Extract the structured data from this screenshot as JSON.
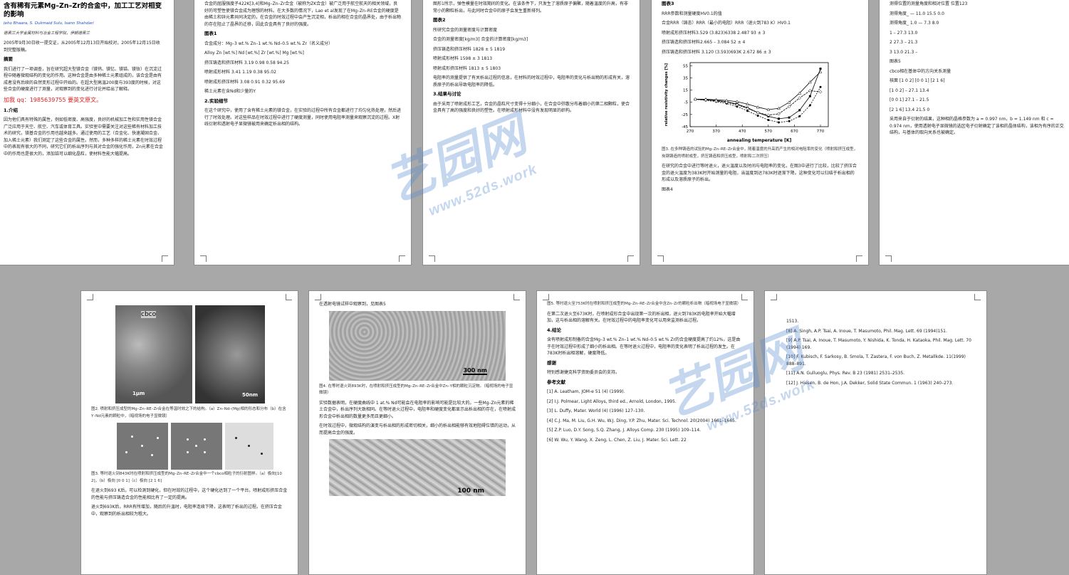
{
  "watermark": {
    "text_cn": "艺园网",
    "url": "www.52ds.work"
  },
  "page1": {
    "title": "含有稀有元素Mg–Zn–Zr的合金中，加工工艺对相变的影响",
    "authors": "Jeho Bhaara, S. Dukmaid Sulu, Isann Shahdari",
    "affil": "德黑兰大学金属材料与冶金工程学院，伊朗德黑兰",
    "dates": "2005年9月30日收一提交证，从2005年12月13日开始校对，2005年12月15日收到完整版稿。",
    "abs_h": "摘要",
    "abs": "我们进行了一项调查，旨在研究超大型镁合金（镁钨、镁钇、镁锆、镁钕）在沉淀过程中随着微观结构的变化的作用。这种合金是由多种稀土元素组成的，该合金是由有成者没有后续的自然变形过程中开始的。在超大型高温200度与393度的时候，对这些合金的硬度进行了测量，对观察到的变化进行讨论并给出了解释。",
    "contact": "加我 qq：1985639755    要英文原文。",
    "intro_h": "1.介绍",
    "intro": "因为他们具有特殊的属性，例如低密度、高强度，良好的机械加工性和实用性镁合金广泛应用于天空、航空、汽车或体育工具。实验室中需要关注对这些稀有材料加工技术的研究，镁基合金的引用也越来越多。通过使用的工艺（合金化、快速凝固合金、加入稀土元素）我们测定了这些合金的属性。然而，多种多样的稀土元素在时效过程中的表现有很大的不同，研究它们的析出序列与其对合金的强化作用，Zn元素在合金中的作用也是很大的，添加锆可以细化晶粒，使材料性能大幅提高。"
  },
  "page2": {
    "p1": "合金的屈服强度子422K[3,4]和Mg–Zn–Zr合金（被称为ZK合金）被广泛用于航空航天的相关领域，良好的可塑性使镁合金成为理想的材料。在大多数的情况下，Lao et al发现了在Mg–Zn–RE合金的硬度是由稀土和锌元素共同决定的，在合金的时效过程中会产生沉淀相，析出的相在合金的晶界处，由于析出物的存在阻止了晶界的迁移，因此合金具有了良好的强度。",
    "list_h": "图表1",
    "list": [
      "合金成分：Mg–3 wt.% Zn–1 wt.% Nd–0.5 wt.% Zr（名义成分）",
      "Alloy Zn [wt.%] Nd [wt.%] Zr [wt.%] Mg [wt.%]",
      "挤压铸造和挤压材料 3.19 0.98 0.58 94.25",
      "喷射成形材料 3.41 1.19 0.38 95.02",
      "喷射成形挤压材料 3.08 0.91 0.32 95.69",
      "稀土元素在含Nd和少量的Y"
    ],
    "method_h": "2.实验细节",
    "method": "在这个研究中，使用了含有稀土元素的镁合金，在实验的过程中所有合金都进行了均匀化热处理，然后进行了时效处理。对这些样品在时效过程中进行了硬度测量，同时使用电阻率测量来观察沉淀的过程。X射线衍射和透射电子显微镜被用来确定析出相的结构。"
  },
  "page3": {
    "p1": "图形1所示，弹性模量在时效期间的变化。在该条件下，只发生了溶质原子偏聚，随着温度的升高，有非常小的颗粒析出，与此同时合金中的原子会发生重新排列。",
    "fig2_h": "图表2",
    "fig2": [
      "所研究合金的测量密度与计算密度",
      "合金的测量密度[kg/m3]    合金的计算密度[kg/m3]",
      "挤压铸造和挤压材料 1828 ± 5 1819",
      "喷射成形材料 1598 ± 3 1813",
      "喷射成形挤压材料 1813 ± 5 1803"
    ],
    "p2": "电阻率的测量提供了有关析出过程的信息，在材料的时效过程中，电阻率的变化与析出物的形成有关，溶质原子的析出导致电阻率的降低。",
    "res_h": "3.结果与讨论",
    "res": "由于采用了喷射成形工艺，合金的晶粒尺寸变得十分细小，在合金中弥散分布着细小的第二相颗粒，使合金具有了高的强度和良好的塑性。在喷射成形材料中没有发现明显的织构。"
  },
  "page4": {
    "fig3_h": "图表3",
    "fig3": [
      "RRR参数和测量硬度HV0.1的值",
      "合金RRR（铸态）RRR（最小的电阻）RRR（退火到783 K）HV0.1",
      "喷射成形挤压材料3.529 (3.823)6338 2.487 93 ± 3",
      "挤压铸造和挤压材料2.665 – 3.084 52 ± 4",
      "挤压铸造和挤压材料 3.120 (3.593)693K 2.672 86 ± 3"
    ],
    "fig3_cap": "图3. 在多种铸造的试验的Mg–Zn–RE–Zr合金中，随着温度的升高而产生的相对电阻率的变化（喷射和挤压成型，炭钢铸造的喷射成型，挤压铸造和挤压成型，喷射和二次挤压）",
    "p1": "在研究的合金中进行等时退火，退火温度以及时间与电阻率的变化，在图3中进行了比较，比较了挤压合金的退火温度为383K时开始测量的电阻，当温度到达783K时逐渐下降。这种变化可以归结于析出相的形成以及溶质原子的析出。",
    "fig4_h": "图表4"
  },
  "page5": {
    "lines": [
      "测得位置的测量角度和相对位置 位置123",
      "测得角度_ — 11.0 15.5 0.0",
      "测得角度_ 1.0 — 7.3 8.0",
      "1 – 27.3 13.0",
      "2 27.3 – 21.3",
      "3 13.0 21.3 –",
      "图表5",
      "cbco相在基体中的方向关系测量",
      "核面 [1 0 2] [0 0 1] [2 1 6]",
      "[1 0 2] – 27.1 13.4",
      "[0 0 1] 27.1 – 21.5",
      "[2 1 6] 13.4 21.5 0"
    ],
    "p1": "采用来自于衍射的结果，这种相的晶格参数为 a = 0.997 nm，b = 1.149 nm 和 c = 0.974 nm，使用透射电子显微镜的选区电子衍射确定了该相的晶体结构，该相为有序的正交结构，与基体的取向关系也被确定。"
  },
  "page6": {
    "cbco": "cbco",
    "scale1": "1μm",
    "scale2": "50nm",
    "fig2_cap": "图2. 喷射和挤压成型的Mg–Zn–RE–Zr合金在等温时效之下的结构。（a）Zn–Nd–(Mg)相的形态和分布（b）在含Y–Nd元素的颗粒中，（暗视场的电子显微镜）",
    "fig3_cap": "图3. 等时退火到843K时在喷射和挤压成型的Mg–Zn–RE–Zr合金中一个cbco相粒子的衍射图样。（a）极向[10 2]，（b）极向 [0 0 1]（c）极向 [2 1 6]",
    "p1": "在退火到693 K后，可以检测到硬化，但在时效的过程中，这个硬化达到了一个平台。喷射成形挤压合金的性能与挤压铸造合金的性能相比有了一定的提高。",
    "p2": "退火到693K后，RRR有所增加，随后的升温时，电阻率连续下降，这表明了析出的过程。在挤压合金中，观察到的析出相较为粗大。"
  },
  "page7": {
    "top": "在透射电镜试样中观察到，见图表5",
    "scale": "300 nm",
    "fig4_cap": "图4. 在等时退火到893K时，在喷射和挤压成型的Mg–Zn–RE–Zr合金中Zn–Y相的颗粒沉淀物。（暗视场的电子显微镜）",
    "p1": "实验数据表明，在硬度曲线中 1 at.% Nd可能会在电阻率的影响可能是比较大的。一些Mg–Zn元素的稀土合金中，析出序列大致相同。在等时退火过程中，电阻率和硬度变化都显示出析出相的存在，在喷射成形合金中析出相的数量更多而且更细小。",
    "p2": "在时效过程中，微观结构的演变与析出相的形成密切相关，细小的析出相能够有效地阻碍位错的运动，从而提高合金的强度。",
    "scale2": "100 nm"
  },
  "page8": {
    "p1": "图5. 等时退火至753K时在喷射和挤压成型的Mg–Zn–RE–Zr合金中含Zn–Zr的颗粒析出物（暗视场电子显微镜）",
    "p2": "在第二次退火至673K时，在喷射成形合金中出现第一次的析出相，退火到783K后电阻率开始大幅增加，这与析出相的溶解有关。在时效过程中的电阻率变化可以用来监测析出过程。",
    "conc_h": "4.结论",
    "conc": "含有喷射成形制备的合金Mg–3 wt.% Zn–1 wt.% Nd–0.5 wt.% Zr的合金硬度提高了约12%，这是由于在时效过程中形成了细小的析出相。在等时退火过程中，电阻率的变化表明了析出过程的发生。在783K时析出相溶解，硬度降低。",
    "ack_h": "感谢",
    "ack": "特别感谢捷克科学资助委员会的支持。",
    "ref_h": "参考文献",
    "refs": [
      "[1] A. Leatham, JOM-e 51 (4) (1999).",
      "[2] I.J. Polmear, Light Alloys, third ed., Arnold, London, 1995.",
      "[3] L. Duffy, Mater. World (4) (1996) 127–130.",
      "[4] C.J. Ma, M. Liu, G.H. Wu, W.J. Ding, Y.P. Zhu, Mater. Sci. Technol. 20(2004) 1661–1665.",
      "[5] Z.P. Luo, D.Y. Song, S.Q. Zhang, J. Alloys Comp. 230 (1995) 109–114.",
      "[6] W. Wu, Y. Wang, X. Zeng, L. Chen, Z. Liu, J. Mater. Sci. Lett. 22"
    ]
  },
  "page9": {
    "refs": [
      "1513.",
      "[8] A. Singh, A.P. Tsai, A. Inoue, T. Masumoto, Phil. Mag. Lett. 69 (1994)151.",
      "[9] A.P. Tsai, A. Inoue, T. Masumoto, Y. Nishida, K. Tonda, H. Kataoka, Phil. Mag. Lett. 70 (1994) 169.",
      "[10] F. Kubisch, F. Sarkosy, B. Smola, T. Zastera, F. von Buch, Z. Metallkde. 11(1999) 888–891.",
      "[11] A.N. Gulluoglu, Phys. Rev. B 23 (1981) 2531–2535.",
      "[12] J. Hiesen, B. de Hon, J.A. Dekker, Solid State Commun. 1 (1963) 240–273."
    ]
  },
  "chart_data": {
    "type": "line",
    "title": "",
    "xlabel": "annealing temperature [K]",
    "ylabel": "relative resistivity changes [%]",
    "xlim": [
      270,
      800
    ],
    "ylim": [
      -45,
      60
    ],
    "xticks": [
      270,
      370,
      470,
      570,
      670,
      770
    ],
    "yticks": [
      55,
      35,
      15,
      -5,
      -25,
      -45
    ],
    "series": [
      {
        "marker": "square",
        "x": [
          290,
          330,
          370,
          410,
          450,
          490,
          530,
          570,
          610,
          650,
          690,
          730,
          770
        ],
        "y": [
          0,
          -1,
          -2,
          -4,
          -8,
          -14,
          -22,
          -28,
          -32,
          -30,
          -18,
          5,
          50
        ]
      },
      {
        "marker": "circle",
        "x": [
          290,
          330,
          370,
          410,
          450,
          490,
          530,
          570,
          610,
          650,
          690,
          730,
          770
        ],
        "y": [
          0,
          -2,
          -4,
          -7,
          -12,
          -19,
          -27,
          -34,
          -38,
          -36,
          -28,
          -10,
          20
        ]
      },
      {
        "marker": "triangle",
        "x": [
          290,
          330,
          370,
          410,
          450,
          490,
          530,
          570,
          610,
          650,
          690,
          730,
          770
        ],
        "y": [
          0,
          0,
          -1,
          -2,
          -4,
          -8,
          -13,
          -17,
          -15,
          -5,
          10,
          28,
          45
        ]
      },
      {
        "marker": "diamond",
        "x": [
          290,
          330,
          370,
          410,
          450,
          490,
          530,
          570,
          610,
          650,
          690,
          730,
          770
        ],
        "y": [
          0,
          -1,
          -3,
          -5,
          -9,
          -15,
          -22,
          -26,
          -24,
          -12,
          2,
          14,
          12
        ]
      }
    ]
  }
}
